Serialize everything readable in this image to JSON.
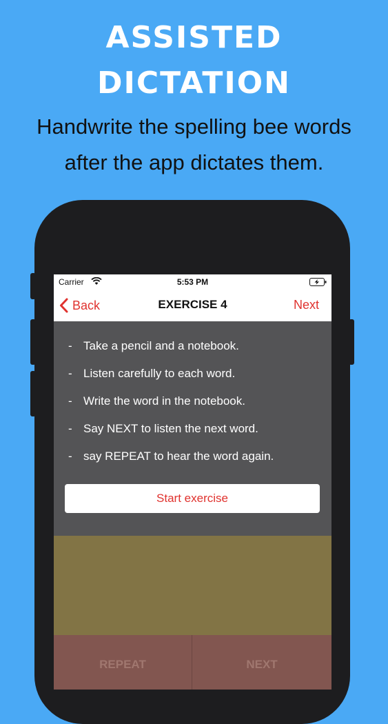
{
  "promo": {
    "headline_line1": "ASSISTED",
    "headline_line2": "DICTATION",
    "subtitle_line1": "Handwrite the spelling bee words",
    "subtitle_line2": "after the app dictates them."
  },
  "statusbar": {
    "carrier": "Carrier",
    "time": "5:53 PM",
    "wifi_icon": "wifi-icon",
    "battery_icon": "battery-charging-icon"
  },
  "navbar": {
    "back_label": "Back",
    "title": "EXERCISE 4",
    "next_label": "Next"
  },
  "instructions": {
    "dash": "-",
    "items": [
      "Take a pencil and a notebook.",
      "Listen carefully to each word.",
      "Write the word in the notebook.",
      "Say NEXT to listen the next word.",
      "say REPEAT to hear the word again."
    ]
  },
  "start_button": {
    "label": "Start exercise"
  },
  "bottom_buttons": {
    "repeat_label": "REPEAT",
    "next_label": "NEXT"
  },
  "colors": {
    "background": "#4aa9f5",
    "accent": "#e0322e",
    "panel": "#545456",
    "olive": "#827445",
    "button_bar": "#825650"
  }
}
